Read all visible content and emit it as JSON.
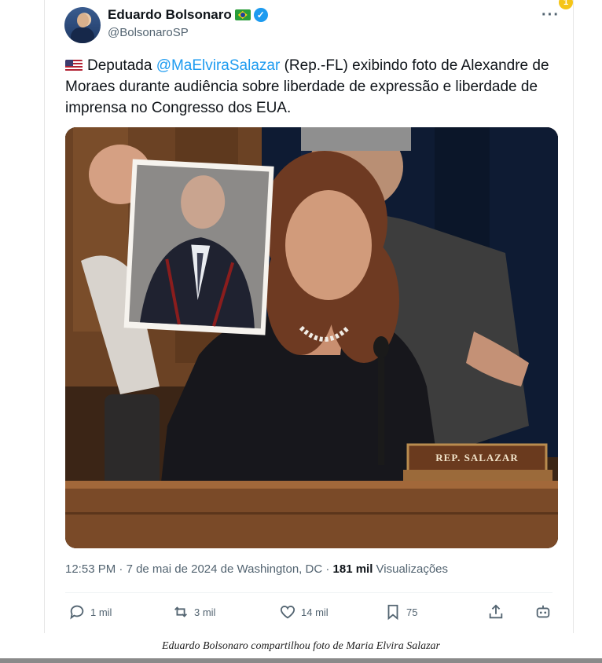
{
  "header": {
    "display_name": "Eduardo Bolsonaro",
    "handle": "@BolsonaroSP",
    "more_icon": "more-icon",
    "notification_badge": "1"
  },
  "tweet": {
    "text_before": "Deputada ",
    "mention": "@MaElviraSalazar",
    "text_after": " (Rep.-FL) exibindo foto de Alexandre de Moraes durante audiência sobre liberdade de expressão e liberdade de imprensa no Congresso dos EUA.",
    "media": {
      "nameplate": "REP. SALAZAR"
    }
  },
  "meta": {
    "time": "12:53 PM",
    "sep1": " · ",
    "date": "7 de mai de 2024",
    "location": " de Washington, DC",
    "sep2": " · ",
    "views_count": "181 mil",
    "views_label": " Visualizações"
  },
  "actions": {
    "replies": "1 mil",
    "retweets": "3 mil",
    "likes": "14 mil",
    "bookmarks": "75"
  },
  "caption": "Eduardo Bolsonaro compartilhou foto de Maria Elvira Salazar",
  "colors": {
    "accent": "#1d9bf0",
    "muted": "#536471"
  }
}
